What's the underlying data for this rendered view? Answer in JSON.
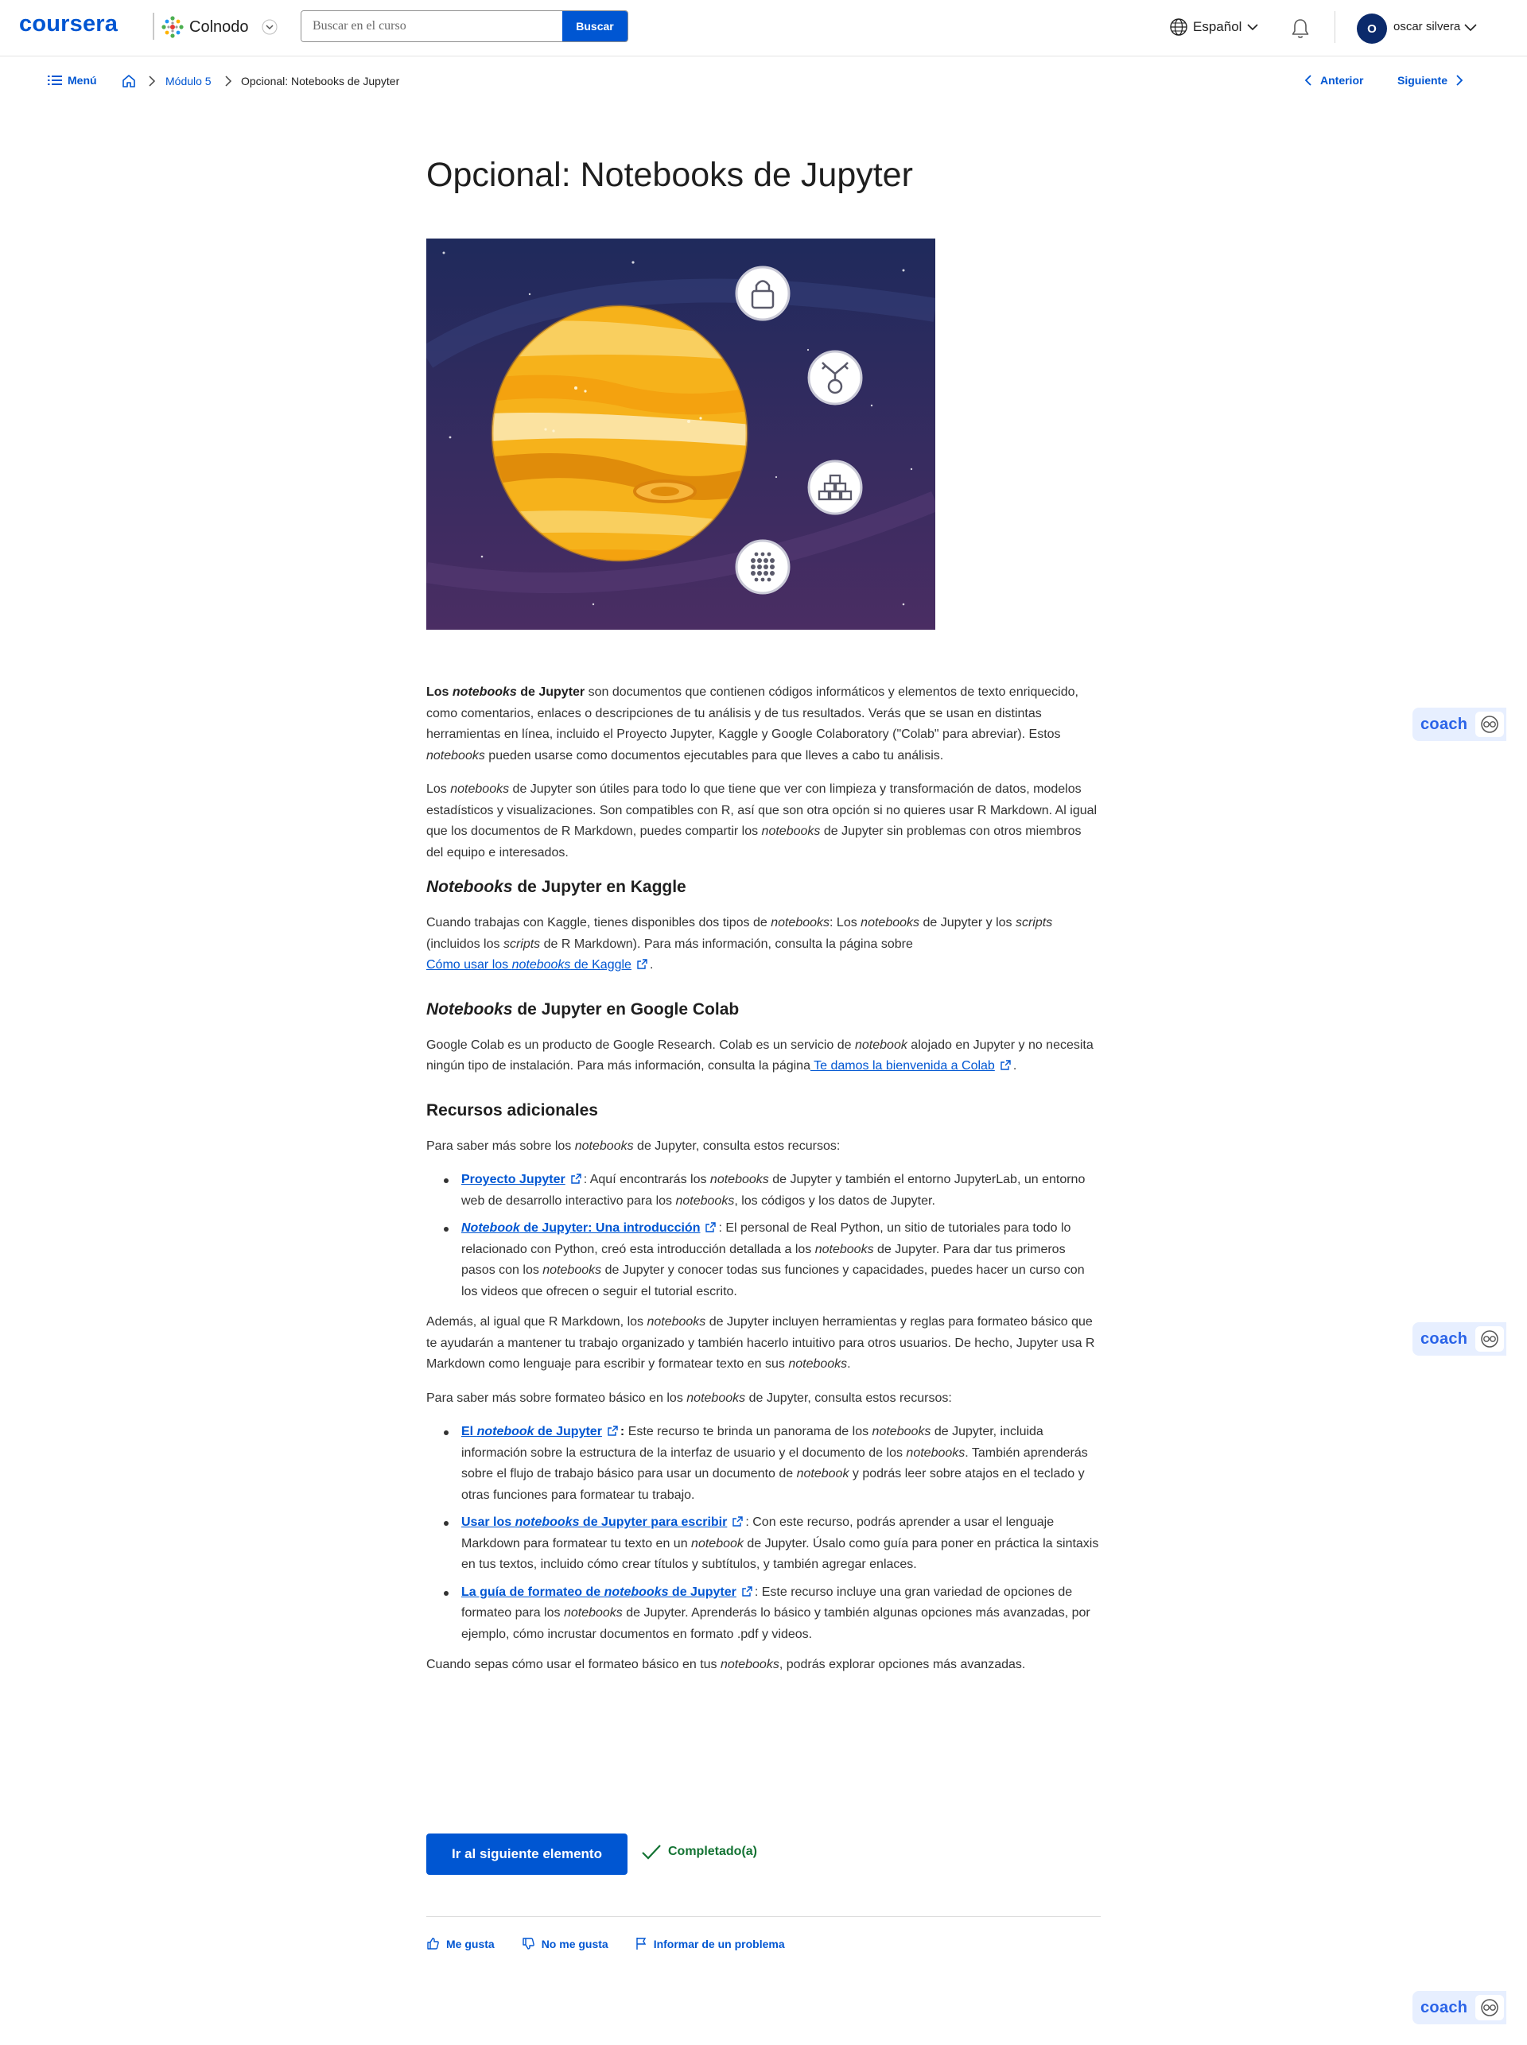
{
  "header": {
    "brand": "coursera",
    "partner": "Colnodo",
    "search": {
      "placeholder": "Buscar en el curso",
      "button": "Buscar"
    },
    "language": "Español",
    "user": {
      "initial": "O",
      "name": "oscar silvera"
    }
  },
  "breadcrumb": {
    "menu": "Menú",
    "module": "Módulo 5",
    "current": "Opcional: Notebooks de Jupyter",
    "prev": "Anterior",
    "next": "Siguiente"
  },
  "page": {
    "title": "Opcional: Notebooks de Jupyter"
  },
  "article": {
    "p1": {
      "a": "Los ",
      "b": "notebooks",
      "c": " de Jupyter",
      "d": " son documentos que contienen códigos informáticos y elementos de texto enriquecido, como comentarios, enlaces o descripciones de tu análisis y de tus resultados. Verás que se usan en distintas herramientas en línea, incluido el Proyecto Jupyter, Kaggle y Google Colaboratory (\"Colab\" para abreviar). Estos ",
      "e": "notebooks",
      "f": " pueden usarse como documentos ejecutables para que lleves a cabo tu análisis."
    },
    "p2": {
      "a": "Los ",
      "b": "notebooks",
      "c": " de Jupyter son útiles para todo lo que tiene que ver con limpieza y transformación de datos, modelos estadísticos y visualizaciones. Son compatibles con R, así que son otra opción si no quieres usar R Markdown. Al igual que los documentos de R Markdown, puedes compartir los ",
      "d": "notebooks",
      "e": " de Jupyter sin problemas con otros miembros del equipo e interesados."
    },
    "h_kaggle": {
      "a": "Notebooks",
      "b": " de Jupyter en Kaggle"
    },
    "p3": {
      "a": "Cuando trabajas con Kaggle, tienes disponibles dos tipos de ",
      "b": "notebooks",
      "c": ": Los ",
      "d": "notebooks",
      "e": " de Jupyter y los ",
      "f": "scripts",
      "g": " (incluidos los ",
      "h": "scripts",
      "i": " de R Markdown). Para más información, consulta la página sobre",
      "link_a": " Cómo usar los ",
      "link_b": "notebooks",
      "link_c": " de Kaggle",
      "end": "."
    },
    "h_colab": {
      "a": "Notebooks",
      "b": " de Jupyter en Google Colab"
    },
    "p4": {
      "a": "Google Colab es un producto de Google Research. Colab es un servicio de ",
      "b": "notebook",
      "c": " alojado en Jupyter y no necesita ningún tipo de instalación. Para más información, consulta la página",
      "link": " Te damos la bienvenida a Colab",
      "end": "."
    },
    "h_resources": "Recursos adicionales",
    "p5": {
      "a": "Para saber más sobre los ",
      "b": "notebooks",
      "c": " de Jupyter, consulta estos recursos:"
    },
    "list1": {
      "i1": {
        "link": "Proyecto Jupyter",
        "a": ": Aquí encontrarás los ",
        "b": "notebooks",
        "c": " de Jupyter y también el entorno JupyterLab, un entorno web de desarrollo interactivo para los ",
        "d": "notebooks",
        "e": ", los códigos y los datos de Jupyter."
      },
      "i2": {
        "link_a": "Notebook",
        "link_b": " de Jupyter: Una introducción",
        "a": ": El personal de Real Python, un sitio de tutoriales para todo lo relacionado con Python, creó esta introducción detallada a los ",
        "b": "notebooks",
        "c": " de Jupyter. Para dar tus primeros pasos con los ",
        "d": "notebooks",
        "e": " de Jupyter y conocer todas sus funciones y capacidades, puedes hacer un curso con los videos que ofrecen o seguir el tutorial escrito."
      }
    },
    "p6": {
      "a": "Además, al igual que R Markdown, los ",
      "b": "notebooks",
      "c": " de Jupyter incluyen herramientas y reglas para formateo básico que te ayudarán a mantener tu trabajo organizado y también hacerlo intuitivo para otros usuarios. De hecho, Jupyter usa R Markdown como lenguaje para escribir y formatear texto en sus ",
      "d": "notebooks",
      "e": "."
    },
    "p7": {
      "a": "Para saber más sobre formateo básico en los ",
      "b": "notebooks",
      "c": " de Jupyter, consulta estos recursos:"
    },
    "list2": {
      "i1": {
        "link_a": "El ",
        "link_b": "notebook",
        "link_c": " de Jupyter",
        "sep": ":",
        "a": " Este recurso te brinda un panorama de los ",
        "b": "notebooks",
        "c": " de Jupyter, incluida información sobre la estructura de la interfaz de usuario y el documento de los ",
        "d": "notebooks",
        "e": ". También aprenderás sobre el flujo de trabajo básico para usar un documento de ",
        "f": "notebook",
        "g": " y podrás leer sobre atajos en el teclado y otras funciones para formatear tu trabajo."
      },
      "i2": {
        "link_a": "Usar los ",
        "link_b": "notebooks",
        "link_c": " de Jupyter para escribir",
        "a": ": Con este recurso, podrás aprender a usar el lenguaje Markdown para formatear tu texto en un ",
        "b": "notebook",
        "c": " de Jupyter. Úsalo como guía para poner en práctica la sintaxis en tus textos, incluido cómo crear títulos y subtítulos, y también agregar enlaces."
      },
      "i3": {
        "link_a": "La guía de formateo de ",
        "link_b": "notebooks",
        "link_c": " de Jupyter",
        "a": ": Este recurso incluye una gran variedad de opciones de formateo para los ",
        "b": "notebooks",
        "c": " de Jupyter. Aprenderás lo básico y también algunas opciones más avanzadas, por ejemplo, cómo incrustar documentos en formato .pdf y videos."
      }
    },
    "p8": {
      "a": "Cuando sepas cómo usar el formateo básico en tus ",
      "b": "notebooks",
      "c": ", podrás explorar opciones más avanzadas."
    }
  },
  "footer": {
    "next_item": "Ir al siguiente elemento",
    "completed": "Completado(a)",
    "like": "Me gusta",
    "dislike": "No me gusta",
    "report": "Informar de un problema"
  },
  "coach": {
    "label": "coach"
  },
  "colors": {
    "brand": "#0056d2",
    "success": "#137333",
    "coach_bg": "#e7efff"
  }
}
